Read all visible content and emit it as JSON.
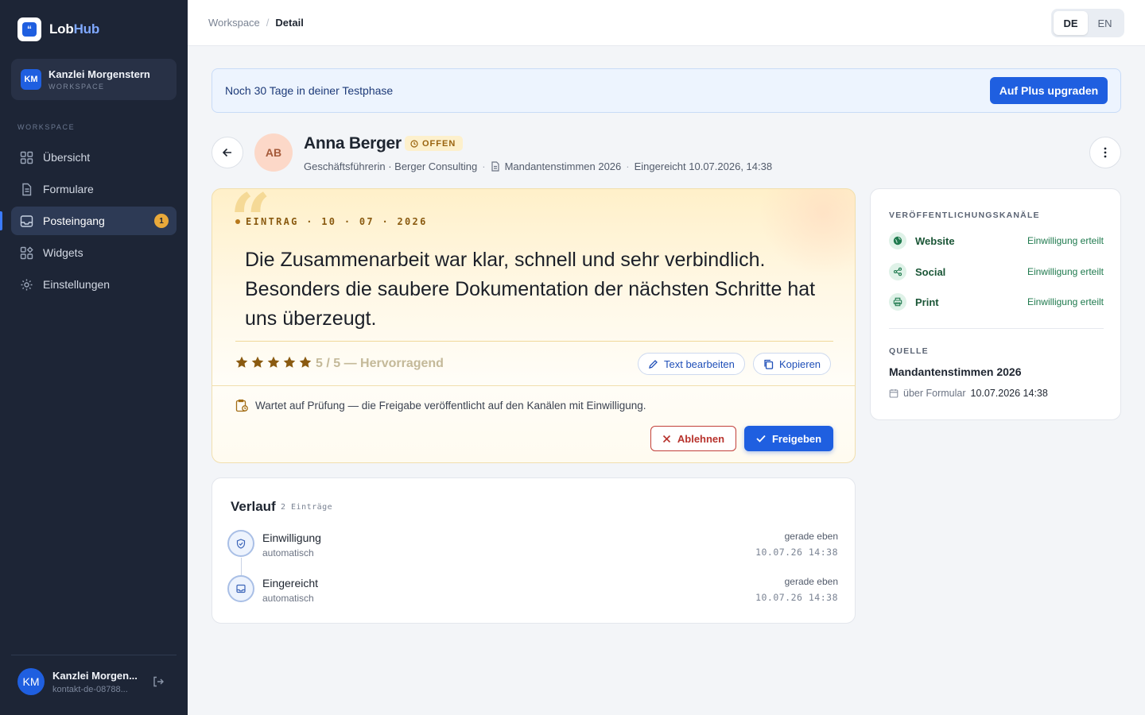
{
  "brand": {
    "name_part1": "Lob",
    "name_part2": "Hub",
    "logo_icon": "quote-icon"
  },
  "workspace": {
    "initials": "KM",
    "name": "Kanzlei Morgenstern",
    "label": "WORKSPACE"
  },
  "sidebar": {
    "heading": "WORKSPACE",
    "items": [
      {
        "label": "Übersicht",
        "icon": "grid-icon"
      },
      {
        "label": "Formulare",
        "icon": "document-icon"
      },
      {
        "label": "Posteingang",
        "icon": "inbox-icon",
        "badge": "1",
        "active": true
      },
      {
        "label": "Widgets",
        "icon": "widgets-icon"
      },
      {
        "label": "Einstellungen",
        "icon": "gear-icon"
      }
    ]
  },
  "user": {
    "initials": "KM",
    "name": "Kanzlei Morgen...",
    "email": "kontakt-de-08788..."
  },
  "breadcrumb": {
    "root": "Workspace",
    "separator": "/",
    "current": "Detail"
  },
  "language": {
    "options": [
      "DE",
      "EN"
    ],
    "selected": "DE"
  },
  "trial": {
    "text": "Noch 30 Tage in deiner Testphase",
    "button": "Auf Plus upgraden"
  },
  "submission": {
    "initials": "AB",
    "name": "Anna Berger",
    "status": "OFFEN",
    "role": "Geschäftsführerin · Berger Consulting",
    "form": "Mandantenstimmen 2026",
    "submitted": "Eingereicht 10.07.2026, 14:38"
  },
  "testimonial": {
    "entry_label": "EINTRAG · 10 · 07 · 2026",
    "quote": "Die Zusammenarbeit war klar, schnell und sehr verbindlich. Besonders die saubere Dokumentation der nächsten Schritte hat uns überzeugt.",
    "rating": 5,
    "rating_max": 5,
    "rating_text": "5 / 5 — Hervorragend",
    "edit_label": "Text bearbeiten",
    "copy_label": "Kopieren",
    "wait_text": "Wartet auf Prüfung — die Freigabe veröffentlicht auf den Kanälen mit Einwilligung.",
    "reject_label": "Ablehnen",
    "approve_label": "Freigeben"
  },
  "history": {
    "title": "Verlauf",
    "count": "2 Einträge",
    "items": [
      {
        "label": "Einwilligung",
        "sub": "automatisch",
        "time": "gerade eben",
        "date": "10.07.26 14:38",
        "icon": "shield-check-icon"
      },
      {
        "label": "Eingereicht",
        "sub": "automatisch",
        "time": "gerade eben",
        "date": "10.07.26 14:38",
        "icon": "inbox-icon"
      }
    ]
  },
  "channels": {
    "heading": "VERÖFFENTLICHUNGSKANÄLE",
    "items": [
      {
        "name": "Website",
        "status": "Einwilligung erteilt",
        "icon": "globe-icon"
      },
      {
        "name": "Social",
        "status": "Einwilligung erteilt",
        "icon": "share-icon"
      },
      {
        "name": "Print",
        "status": "Einwilligung erteilt",
        "icon": "printer-icon"
      }
    ]
  },
  "source": {
    "heading": "QUELLE",
    "name": "Mandantenstimmen 2026",
    "via": "über Formular",
    "date": "10.07.2026 14:38"
  },
  "colors": {
    "accent": "#1f5fe0",
    "sidebar": "#1d2536",
    "star": "#8a5a10",
    "success": "#1f7a4e",
    "danger": "#b8332d"
  }
}
